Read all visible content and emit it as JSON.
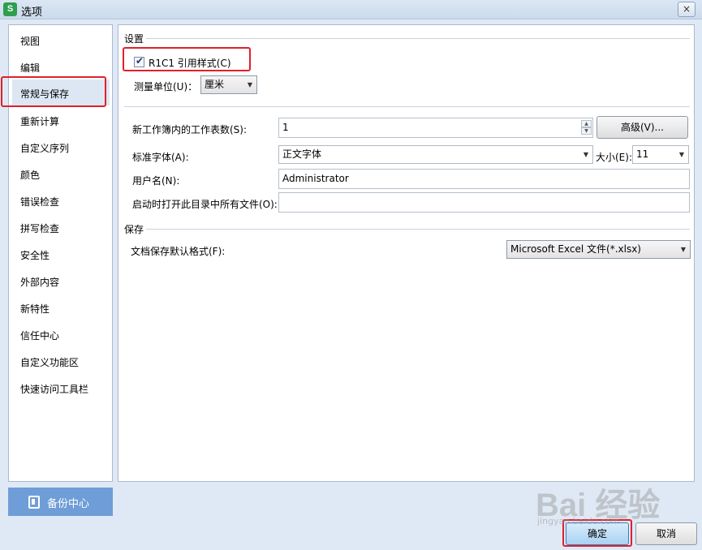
{
  "window": {
    "title": "选项",
    "app_icon_letter": "S",
    "close_glyph": "×"
  },
  "nav": {
    "items": [
      "视图",
      "编辑",
      "常规与保存",
      "重新计算",
      "自定义序列",
      "颜色",
      "错误检查",
      "拼写检查",
      "安全性",
      "外部内容",
      "新特性",
      "信任中心",
      "自定义功能区",
      "快速访问工具栏"
    ],
    "active": "常规与保存"
  },
  "backup": {
    "label": "备份中心"
  },
  "settings": {
    "section_title": "设置",
    "r1c1_label": "R1C1 引用样式(C)",
    "r1c1_checked": true,
    "unit_label": "测量单位(U)：",
    "unit_value": "厘米",
    "sheets_label": "新工作簿内的工作表数(S):",
    "sheets_value": "1",
    "advanced_button": "高级(V)...",
    "font_label": "标准字体(A):",
    "font_value": "正文字体",
    "size_label": "大小(E):",
    "size_value": "11",
    "username_label": "用户名(N):",
    "username_value": "Administrator",
    "startup_label": "启动时打开此目录中所有文件(O):",
    "startup_value": ""
  },
  "save": {
    "section_title": "保存",
    "format_label": "文档保存默认格式(F):",
    "format_value": "Microsoft Excel 文件(*.xlsx)"
  },
  "footer": {
    "ok": "确定",
    "cancel": "取消"
  },
  "watermark": {
    "text": "Bai 经验",
    "sub": "jingyan.baidu.com"
  },
  "colors": {
    "highlight": "#e0202a",
    "nav_active_bg": "#dce7f3",
    "backup_bg": "#6f9dd7"
  }
}
